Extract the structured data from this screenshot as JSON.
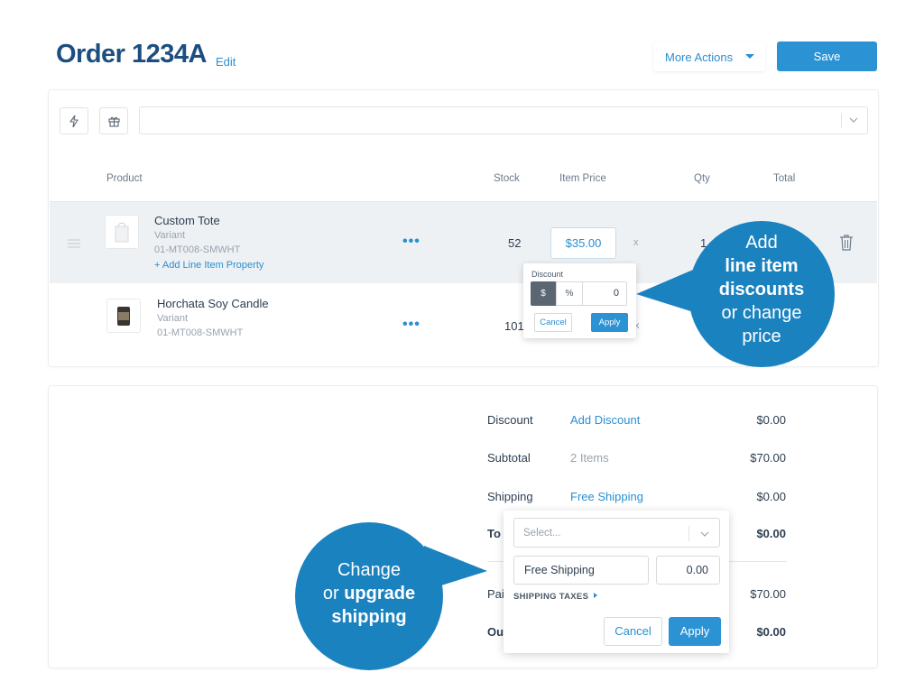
{
  "header": {
    "title": "Order 1234A",
    "edit_label": "Edit",
    "more_actions_label": "More Actions",
    "save_label": "Save"
  },
  "toolbar": {
    "search_value": ""
  },
  "table": {
    "columns": [
      "Product",
      "Stock",
      "Item Price",
      "Qty",
      "Total"
    ],
    "rows": [
      {
        "name": "Custom Tote",
        "variant": "Variant",
        "sku": "01-MT008-SMWHT",
        "add_property": "+ Add Line Item Property",
        "stock": "52",
        "price": "$35.00",
        "times": "x",
        "qty": "1"
      },
      {
        "name": "Horchata Soy Candle",
        "variant": "Variant",
        "sku": "01-MT008-SMWHT",
        "stock": "101",
        "times": "x"
      }
    ]
  },
  "discount_popover": {
    "label": "Discount",
    "dollar": "$",
    "percent": "%",
    "value": "0",
    "cancel": "Cancel",
    "apply": "Apply"
  },
  "summary": {
    "discount": {
      "label": "Discount",
      "link": "Add Discount",
      "value": "$0.00"
    },
    "subtotal": {
      "label": "Subtotal",
      "items": "2 Items",
      "value": "$70.00"
    },
    "shipping": {
      "label": "Shipping",
      "link": "Free Shipping",
      "value": "$0.00"
    },
    "total": {
      "label": "To",
      "value": "$0.00"
    },
    "paid": {
      "label": "Pai",
      "value": "$70.00"
    },
    "outstanding": {
      "label": "Ou",
      "value": "$0.00"
    }
  },
  "shipping_popover": {
    "select_placeholder": "Select...",
    "method_name": "Free Shipping",
    "method_price": "0.00",
    "taxes_label": "SHIPPING TAXES",
    "cancel": "Cancel",
    "apply": "Apply"
  },
  "callouts": {
    "discount": {
      "line1": "Add",
      "line2": "line item",
      "line3": "discounts",
      "line4": "or change",
      "line5": "price"
    },
    "shipping": {
      "line1": "Change",
      "line2a": "or ",
      "line2b": "upgrade",
      "line3": "shipping"
    }
  },
  "colors": {
    "brand_dark": "#1c4e80",
    "accent": "#2b93d4",
    "callout": "#1b82c0"
  }
}
